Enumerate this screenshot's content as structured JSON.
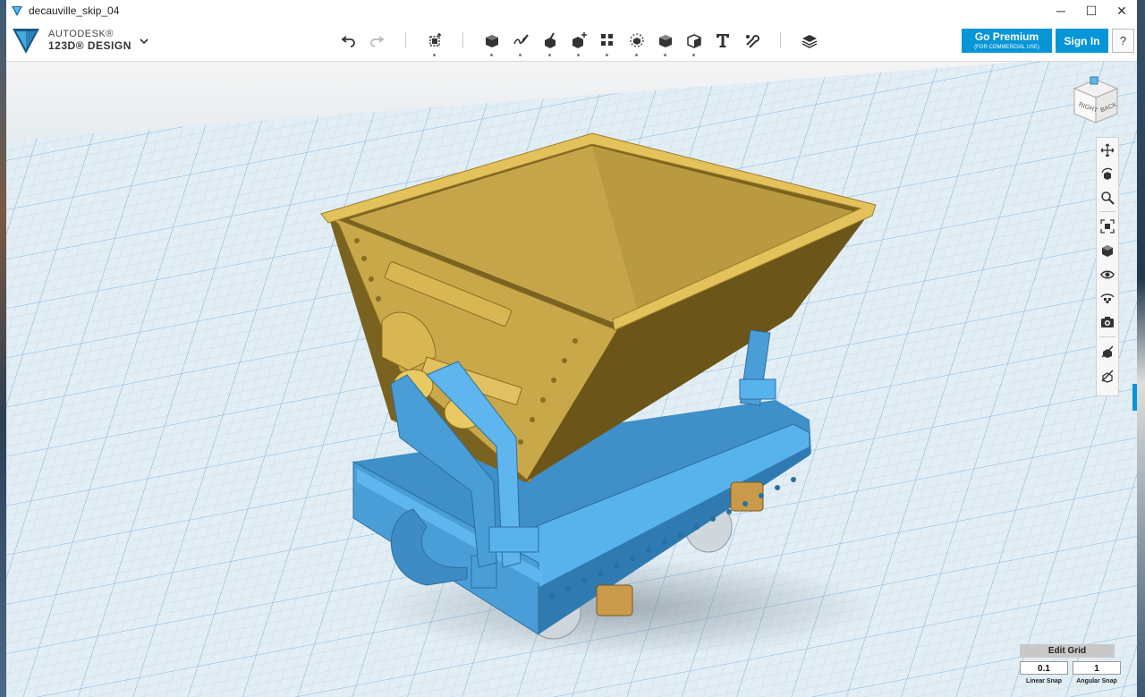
{
  "window": {
    "title": "decauville_skip_04",
    "minimize_glyph": "─",
    "maximize_glyph": "☐",
    "close_glyph": "✕"
  },
  "app": {
    "brand_line1": "AUTODESK®",
    "brand_line2": "123D® DESIGN",
    "accent_color": "#0696d7"
  },
  "toolbar": {
    "tools": [
      {
        "name": "undo-icon"
      },
      {
        "name": "redo-icon"
      },
      {
        "name": "transform-icon"
      },
      {
        "name": "primitives-icon"
      },
      {
        "name": "sketch-icon"
      },
      {
        "name": "construct-icon"
      },
      {
        "name": "modify-icon"
      },
      {
        "name": "pattern-icon"
      },
      {
        "name": "grouping-icon"
      },
      {
        "name": "combine-icon"
      },
      {
        "name": "measure-icon"
      },
      {
        "name": "text-icon"
      },
      {
        "name": "snap-icon"
      },
      {
        "name": "material-icon"
      }
    ],
    "premium_label": "Go Premium",
    "premium_sublabel": "(FOR COMMERCIAL USE)",
    "signin_label": "Sign In",
    "help_label": "?"
  },
  "viewcube": {
    "face_right": "RIGHT",
    "face_back": "BACK"
  },
  "navbar": {
    "items": [
      "pan-icon",
      "orbit-icon",
      "zoom-icon",
      "fit-icon",
      "view-icon",
      "visibility-icon",
      "materials-icon",
      "camera-icon",
      "outline-icon",
      "hide-icon"
    ]
  },
  "grid": {
    "edit_label": "Edit Grid",
    "linear_value": "0.1",
    "angular_value": "1",
    "linear_label": "Linear Snap",
    "angular_label": "Angular Snap"
  },
  "scene": {
    "model": "mine skip cart",
    "hopper_color": "#c9a84a",
    "chassis_color": "#4ea3e0",
    "grid_color": "#9cc8e4"
  }
}
